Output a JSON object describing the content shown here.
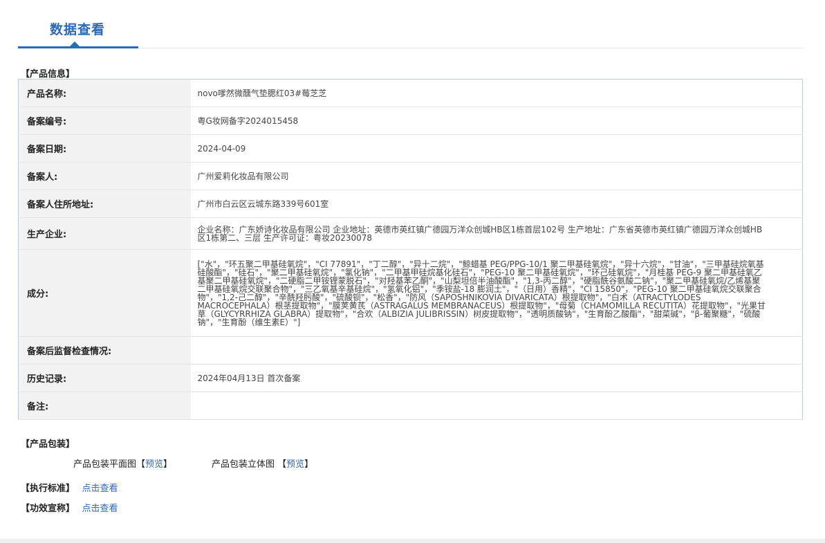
{
  "header": {
    "tab_title": "数据查看"
  },
  "sections": {
    "product_info": "【产品信息】",
    "packaging": "【产品包装】",
    "standard": "【执行标准】",
    "claims": "【功效宣称】"
  },
  "info_rows": [
    {
      "label": "产品名称:",
      "value": "novo嗲然微醺气垫腮红03#莓芝芝"
    },
    {
      "label": "备案编号:",
      "value": "粤G妆网备字2024015458"
    },
    {
      "label": "备案日期:",
      "value": "2024-04-09"
    },
    {
      "label": "备案人:",
      "value": "广州爱莉化妆品有限公司"
    },
    {
      "label": "备案人住所地址:",
      "value": "广州市白云区云城东路339号601室"
    },
    {
      "label": "生产企业:",
      "value": "企业名称：广东娇诗化妆品有限公司 企业地址：英德市英红镇广德园万洋众创城HB区1栋首层102号 生产地址：广东省英德市英红镇广德园万洋众创城HB区1栋第二、三层 生产许可证：粤妆20230078"
    },
    {
      "label": "成分:",
      "value": "[\"水\"，\"环五聚二甲基硅氧烷\"，\"CI 77891\"，\"丁二醇\"，\"异十二烷\"，\"鲸蜡基 PEG/PPG-10/1 聚二甲基硅氧烷\"，\"异十六烷\"，\"甘油\"，\"三甲基硅烷氧基硅酸酯\"，\"硅石\"，\"聚二甲基硅氧烷\"，\"氯化钠\"，\"二甲基甲硅烷基化硅石\"，\"PEG-10 聚二甲基硅氧烷\"，\"环己硅氧烷\"，\"月桂基 PEG-9 聚二甲基硅氧乙基聚二甲基硅氧烷\"，\"二硬脂二甲铵锂蒙脱石\"，\"对羟基苯乙酮\"，\"山梨坦倍半油酸酯\"，\"1,3-丙二醇\"，\"硬脂酰谷氨酸二钠\"，\"聚二甲基硅氧烷/乙烯基聚二甲基硅氧烷交联聚合物\"，\"三乙氧基辛基硅烷\"，\"氢氧化铝\"，\"季铵盐-18 膨润土\"，\"（日用）香精\"，\"CI 15850\"，\"PEG-10 聚二甲基硅氧烷交联聚合物\"，\"1,2-己二醇\"，\"辛酰羟肟酸\"，\"硫酸钡\"，\"松香\"，\"防风（SAPOSHNIKOVIA DIVARICATA）根提取物\"，\"白术（ATRACTYLODES MACROCEPHALA）根茎提取物\"，\"膜荚黄芪（ASTRAGALUS MEMBRANACEUS）根提取物\"，\"母菊（CHAMOMILLA RECUTITA）花提取物\"，\"光果甘草（GLYCYRRHIZA GLABRA）提取物\"，\"合欢（ALBIZIA JULIBRISSIN）树皮提取物\"，\"透明质酸钠\"，\"生育酚乙酸酯\"，\"甜菜碱\"，\"β-葡聚糖\"，\"硫酸钠\"，\"生育酚（维生素E）\"]"
    },
    {
      "label": "备案后监督检查情况:",
      "value": ""
    },
    {
      "label": "历史记录:",
      "value": "2024年04月13日 首次备案"
    },
    {
      "label": "备注:",
      "value": ""
    }
  ],
  "packaging": {
    "flat_label": "产品包装平面图",
    "flat_preview": "预览",
    "stereo_label": "产品包装立体图",
    "stereo_preview": "预览"
  },
  "standard_link": "点击查看",
  "claims_link": "点击查看"
}
